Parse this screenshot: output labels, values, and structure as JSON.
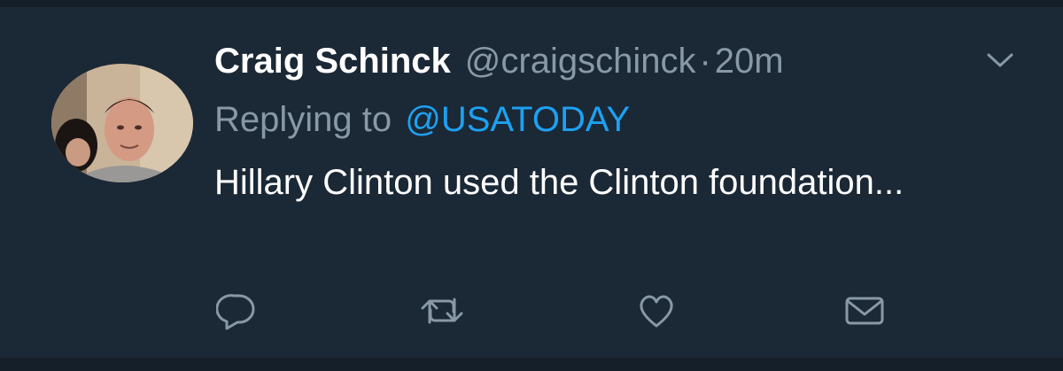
{
  "tweet": {
    "display_name": "Craig Schinck",
    "handle": "@craigschinck",
    "separator": "·",
    "time": "20m",
    "replying_prefix": "Replying to",
    "replying_to": "@USATODAY",
    "text": "Hillary Clinton used the Clinton foundation..."
  },
  "icons": {
    "caret": "chevron-down-icon",
    "reply": "reply-icon",
    "retweet": "retweet-icon",
    "like": "heart-icon",
    "dm": "envelope-icon"
  },
  "colors": {
    "background": "#1b2836",
    "divider": "#151f2a",
    "primary_text": "#ffffff",
    "secondary_text": "#8899a6",
    "link": "#1da1f2"
  }
}
